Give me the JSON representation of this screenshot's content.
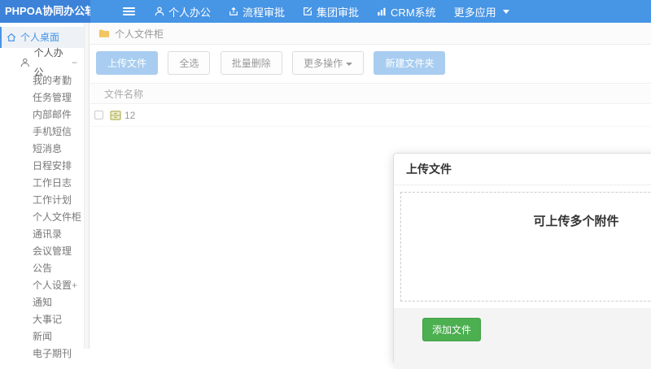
{
  "navbar": {
    "logo": "PHPOA协同办公软件",
    "items": [
      {
        "label": "个人办公",
        "icon": "user-icon"
      },
      {
        "label": "流程审批",
        "icon": "process-approval-icon"
      },
      {
        "label": "集团审批",
        "icon": "group-approval-icon"
      },
      {
        "label": "CRM系统",
        "icon": "crm-chart-icon"
      },
      {
        "label": "更多应用",
        "icon": "caret-down-icon"
      }
    ]
  },
  "sidebar": {
    "desktop": "个人桌面",
    "group": {
      "label": "个人办公",
      "indicator": "−"
    },
    "items": [
      "我的考勤",
      "任务管理",
      "内部邮件",
      "手机短信",
      "短消息",
      "日程安排",
      "工作日志",
      "工作计划",
      "个人文件柜",
      "通讯录",
      "会议管理",
      "公告"
    ],
    "settings": {
      "label": "个人设置",
      "indicator": "+"
    },
    "more": [
      "通知",
      "大事记",
      "新闻",
      "电子期刊"
    ]
  },
  "main": {
    "breadcrumb": "个人文件柜",
    "toolbar": {
      "upload": "上传文件",
      "select_all": "全选",
      "batch_delete": "批量删除",
      "more_actions": "更多操作",
      "new_folder": "新建文件夹"
    },
    "table": {
      "name_header": "文件名称",
      "rows": [
        {
          "name": "12",
          "icon": "cabinet-icon"
        }
      ]
    }
  },
  "modal": {
    "title": "上传文件",
    "dropzone_text": "可上传多个附件",
    "add_file_label": "添加文件"
  },
  "colors": {
    "navbar_bg": "#4795e5",
    "logo_bg": "#3c82d9",
    "accent_blue": "#4795e5",
    "light_primary_button": "#a8cdf0",
    "success_green": "#4caf50",
    "folder_yellow": "#f2c661",
    "cabinet_olive": "#b3b25e"
  }
}
